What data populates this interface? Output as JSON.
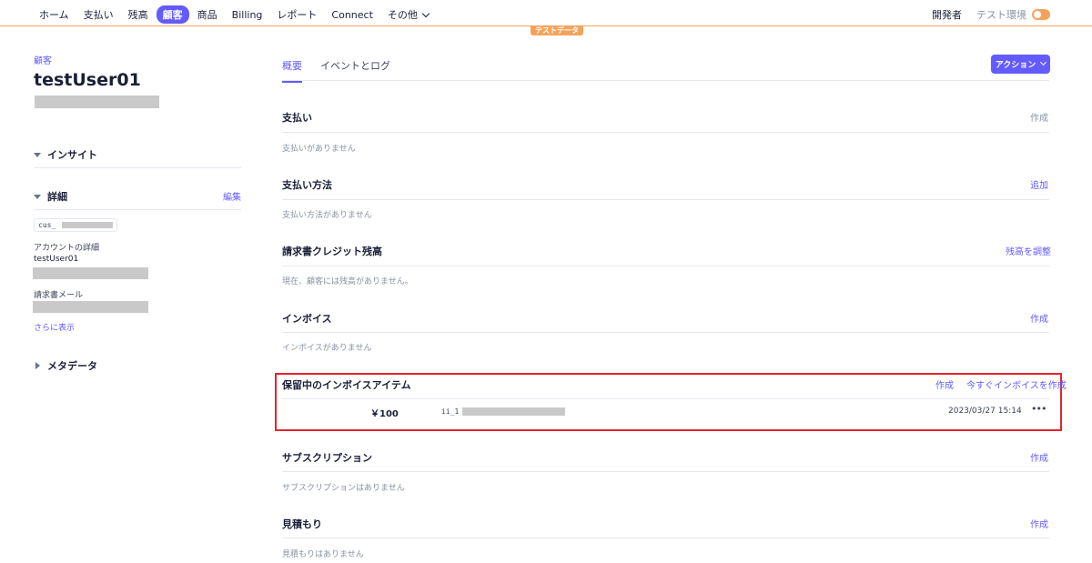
{
  "nav": {
    "items": [
      "ホーム",
      "支払い",
      "残高",
      "顧客",
      "商品",
      "Billing",
      "レポート",
      "Connect",
      "その他"
    ],
    "active_index": 3,
    "developers": "開発者",
    "test_mode": "テスト環境",
    "test_badge": "テストデータ"
  },
  "sidebar": {
    "breadcrumb": "顧客",
    "title": "testUser01",
    "insight_label": "インサイト",
    "details_label": "詳細",
    "edit_label": "編集",
    "customer_id_prefix": "cus_",
    "account_details_label": "アカウントの詳細",
    "account_name": "testUser01",
    "invoice_email_label": "請求書メール",
    "show_more": "さらに表示",
    "metadata_label": "メタデータ"
  },
  "main": {
    "tabs": [
      "概要",
      "イベントとログ"
    ],
    "action_button": "アクション",
    "sections": {
      "payments": {
        "title": "支払い",
        "link": "作成",
        "empty": "支払いがありません"
      },
      "payment_methods": {
        "title": "支払い方法",
        "link": "追加",
        "empty": "支払い方法がありません"
      },
      "credit_balance": {
        "title": "請求書クレジット残高",
        "link": "残高を調整",
        "empty": "現在、顧客には残高がありません。"
      },
      "invoices": {
        "title": "インボイス",
        "link": "作成",
        "empty": "インボイスがありません"
      },
      "pending_items": {
        "title": "保留中のインボイスアイテム",
        "link_create": "作成",
        "link_invoice_now": "今すぐインボイスを作成",
        "item": {
          "amount": "￥100",
          "id_prefix": "ii_1",
          "date": "2023/03/27 15:14",
          "more": "•••"
        }
      },
      "subscriptions": {
        "title": "サブスクリプション",
        "link": "作成",
        "empty": "サブスクリプションはありません"
      },
      "quotes": {
        "title": "見積もり",
        "link": "作成",
        "empty": "見積もりはありません"
      }
    }
  },
  "colors": {
    "accent": "#635bff",
    "test_orange": "#f5a35c",
    "highlight_red": "#e8232f"
  }
}
